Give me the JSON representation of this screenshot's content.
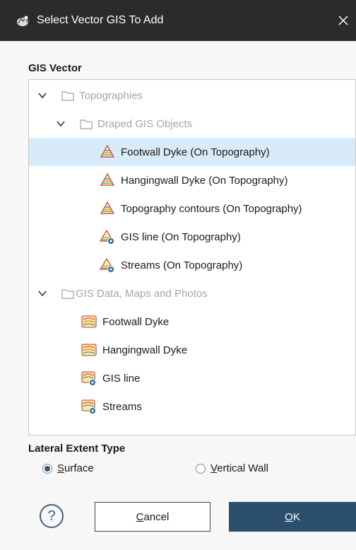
{
  "window": {
    "title": "Select Vector GIS To Add",
    "close_glyph": "×"
  },
  "gis_vector": {
    "label": "GIS Vector",
    "tree": [
      {
        "label": "Topographies",
        "kind": "folder",
        "icon": "folder-icon"
      },
      {
        "label": "Draped GIS Objects",
        "kind": "folder",
        "icon": "folder-icon"
      },
      {
        "label": "Footwall Dyke (On Topography)",
        "kind": "item",
        "icon": "draped-polygon-icon",
        "selected": true
      },
      {
        "label": "Hangingwall Dyke (On Topography)",
        "kind": "item",
        "icon": "draped-polygon-icon"
      },
      {
        "label": "Topography contours (On Topography)",
        "kind": "item",
        "icon": "draped-polygon-icon"
      },
      {
        "label": "GIS line (On Topography)",
        "kind": "item",
        "icon": "draped-line-icon"
      },
      {
        "label": "Streams (On Topography)",
        "kind": "item",
        "icon": "draped-line-icon"
      },
      {
        "label": "GIS Data, Maps and Photos",
        "kind": "folder",
        "icon": "folder-icon"
      },
      {
        "label": "Footwall Dyke",
        "kind": "item",
        "icon": "gis-polygon-icon"
      },
      {
        "label": "Hangingwall Dyke",
        "kind": "item",
        "icon": "gis-polygon-icon"
      },
      {
        "label": "GIS line",
        "kind": "item",
        "icon": "gis-line-icon"
      },
      {
        "label": "Streams",
        "kind": "item",
        "icon": "gis-line-icon"
      }
    ]
  },
  "lateral_extent": {
    "label": "Lateral Extent Type",
    "options": [
      {
        "mnemonic": "S",
        "rest": "urface",
        "selected": true
      },
      {
        "mnemonic": "V",
        "rest": "ertical Wall",
        "selected": false
      }
    ]
  },
  "buttons": {
    "help": "?",
    "cancel": {
      "mnemonic": "C",
      "rest": "ancel"
    },
    "ok": {
      "mnemonic": "O",
      "rest": "K"
    }
  },
  "colors": {
    "selection": "#d9ebf9",
    "ok_button": "#2d4f6e",
    "titlebar": "#2b2b2b"
  }
}
